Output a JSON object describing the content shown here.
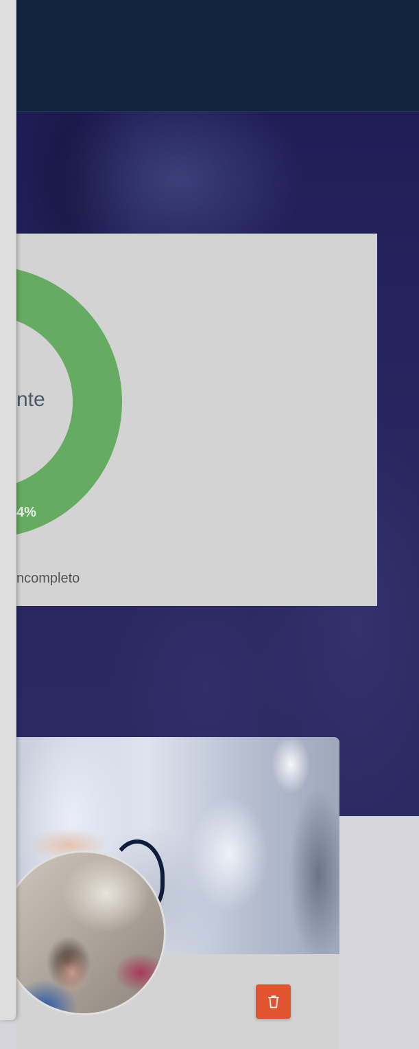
{
  "chart_data": {
    "type": "pie",
    "center_label": "nte",
    "slices": [
      {
        "label": "4%",
        "color": "#66ab62"
      }
    ],
    "legend": [
      "ncompleto"
    ]
  },
  "profile": {
    "avatar_icon": "user-photo",
    "delete_icon": "trash-icon"
  },
  "colors": {
    "topbar": "#12233f",
    "hero": "#26235e",
    "donut": "#66ab62",
    "card": "#d3d3d3",
    "delete": "#e0552f"
  }
}
